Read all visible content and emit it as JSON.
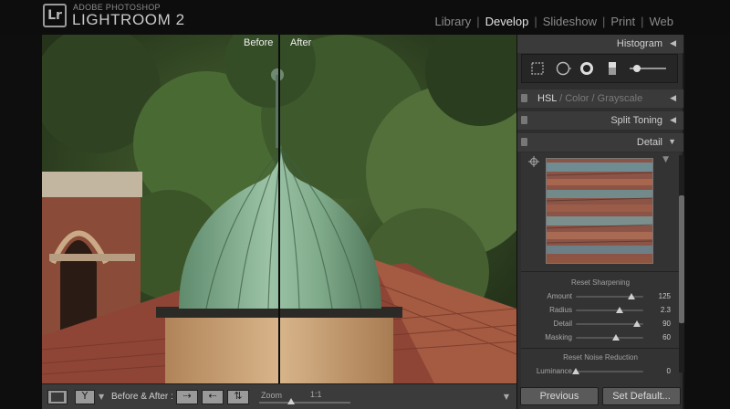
{
  "app": {
    "logo_letters": "Lr",
    "brand_small": "ADOBE PHOTOSHOP",
    "brand_big": "LIGHTROOM 2"
  },
  "modules": [
    {
      "label": "Library",
      "active": false
    },
    {
      "label": "Develop",
      "active": true
    },
    {
      "label": "Slideshow",
      "active": false
    },
    {
      "label": "Print",
      "active": false
    },
    {
      "label": "Web",
      "active": false
    }
  ],
  "photo": {
    "before_label": "Before",
    "after_label": "After"
  },
  "panels": {
    "histogram": "Histogram",
    "hsl": "HSL",
    "hsl_sep1": "/",
    "color": "Color",
    "hsl_sep2": "/",
    "grayscale": "Grayscale",
    "split_toning": "Split Toning",
    "detail": "Detail"
  },
  "detail": {
    "reset_sharpening": "Reset Sharpening",
    "sharpening": [
      {
        "label": "Amount",
        "value": "125",
        "fraction": 0.83
      },
      {
        "label": "Radius",
        "value": "2.3",
        "fraction": 0.65
      },
      {
        "label": "Detail",
        "value": "90",
        "fraction": 0.9
      },
      {
        "label": "Masking",
        "value": "60",
        "fraction": 0.6
      }
    ],
    "reset_noise": "Reset Noise Reduction",
    "noise": [
      {
        "label": "Luminance",
        "value": "0",
        "fraction": 0.0
      }
    ]
  },
  "toolbar": {
    "before_after_label": "Before & After :",
    "zoom_label": "Zoom",
    "zoom_value": "1:1",
    "zoom_fraction": 0.35
  },
  "buttons": {
    "previous": "Previous",
    "set_default": "Set Default..."
  },
  "icons": {
    "crop": "crop-icon",
    "spot": "spot-removal-icon",
    "redeye": "red-eye-icon",
    "gradient": "graduated-filter-icon",
    "brush": "adjustment-brush-icon",
    "target": "target-adjust-icon"
  }
}
